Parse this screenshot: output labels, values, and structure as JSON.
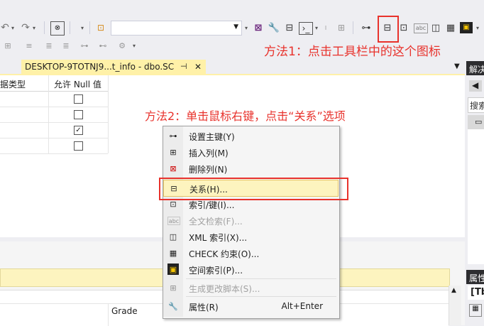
{
  "toolbar": {
    "combo_value": "",
    "icons_row1": [
      "undo-icon",
      "redo-icon",
      "solution-icon",
      "search-icon",
      "relationships-icon",
      "wrench-icon",
      "toolbox-icon",
      "terminal-icon",
      "key-icon",
      "indexes-icon",
      "fulltext-icon",
      "xml-index-icon",
      "check-constraints-icon",
      "spatial-index-icon"
    ]
  },
  "annotations": {
    "method1": "方法1：点击工具栏中的这个图标",
    "method2": "方法2：单击鼠标右键，点击“关系”选项"
  },
  "document_tab": {
    "title": "DESKTOP-9TOTNJ9...t_info - dbo.SC",
    "pin": "⊣",
    "close": "✕"
  },
  "grid": {
    "headers": [
      "据类型",
      "允许 Null 值"
    ],
    "rows": [
      {
        "allow_null": false
      },
      {
        "allow_null": false
      },
      {
        "allow_null": true
      },
      {
        "allow_null": false
      }
    ]
  },
  "context_menu": {
    "items": [
      {
        "label": "设置主键(Y)",
        "icon": "⊶",
        "shortcut": "",
        "disabled": false,
        "highlighted": false
      },
      {
        "label": "插入列(M)",
        "icon": "⊞",
        "shortcut": "",
        "disabled": false,
        "highlighted": false
      },
      {
        "label": "删除列(N)",
        "icon": "⊠",
        "shortcut": "",
        "disabled": false,
        "highlighted": false
      },
      {
        "label": "关系(H)...",
        "icon": "⊟",
        "shortcut": "",
        "disabled": false,
        "highlighted": true
      },
      {
        "label": "索引/键(I)...",
        "icon": "⊡",
        "shortcut": "",
        "disabled": false,
        "highlighted": false
      },
      {
        "label": "全文检索(F)...",
        "icon": "abc",
        "shortcut": "",
        "disabled": true,
        "highlighted": false
      },
      {
        "label": "XML 索引(X)...",
        "icon": "◫",
        "shortcut": "",
        "disabled": false,
        "highlighted": false
      },
      {
        "label": "CHECK 约束(O)...",
        "icon": "▦",
        "shortcut": "",
        "disabled": false,
        "highlighted": false
      },
      {
        "label": "空间索引(P)...",
        "icon": "▣",
        "shortcut": "",
        "disabled": false,
        "highlighted": false
      },
      {
        "label": "生成更改脚本(S)...",
        "icon": "⊞",
        "shortcut": "",
        "disabled": true,
        "highlighted": false
      },
      {
        "label": "属性(R)",
        "icon": "🔧",
        "shortcut": "Alt+Enter",
        "disabled": false,
        "highlighted": false
      }
    ]
  },
  "lower_pane": {
    "grade_label": "Grade"
  },
  "right_panels": {
    "solution_title": "解决",
    "search_placeholder": "搜索",
    "properties_title": "属性",
    "properties_item": "[Tb"
  }
}
